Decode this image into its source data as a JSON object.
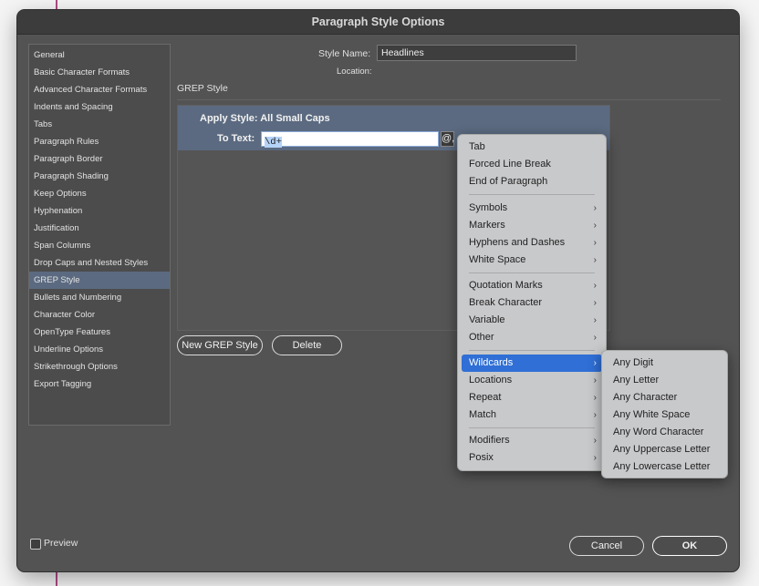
{
  "dialog": {
    "title": "Paragraph Style Options",
    "style_name_label": "Style Name:",
    "style_name_value": "Headlines",
    "location_label": "Location:",
    "section_title": "GREP Style"
  },
  "sidebar": {
    "items": [
      {
        "label": "General"
      },
      {
        "label": "Basic Character Formats"
      },
      {
        "label": "Advanced Character Formats"
      },
      {
        "label": "Indents and Spacing"
      },
      {
        "label": "Tabs"
      },
      {
        "label": "Paragraph Rules"
      },
      {
        "label": "Paragraph Border"
      },
      {
        "label": "Paragraph Shading"
      },
      {
        "label": "Keep Options"
      },
      {
        "label": "Hyphenation"
      },
      {
        "label": "Justification"
      },
      {
        "label": "Span Columns"
      },
      {
        "label": "Drop Caps and Nested Styles"
      },
      {
        "label": "GREP Style"
      },
      {
        "label": "Bullets and Numbering"
      },
      {
        "label": "Character Color"
      },
      {
        "label": "OpenType Features"
      },
      {
        "label": "Underline Options"
      },
      {
        "label": "Strikethrough Options"
      },
      {
        "label": "Export Tagging"
      }
    ],
    "selected": "GREP Style"
  },
  "grep": {
    "apply_style": "Apply Style: All Small Caps",
    "to_text_label": "To Text:",
    "to_text_value": "\\d+",
    "special_char_button": "@,"
  },
  "buttons": {
    "new_grep": "New GREP Style",
    "delete": "Delete",
    "cancel": "Cancel",
    "ok": "OK"
  },
  "preview": {
    "label": "Preview",
    "checked": false
  },
  "menu": {
    "items": [
      {
        "label": "Tab"
      },
      {
        "label": "Forced Line Break"
      },
      {
        "label": "End of Paragraph"
      },
      {
        "label": "Symbols"
      },
      {
        "label": "Markers"
      },
      {
        "label": "Hyphens and Dashes"
      },
      {
        "label": "White Space"
      },
      {
        "label": "Quotation Marks"
      },
      {
        "label": "Break Character"
      },
      {
        "label": "Variable"
      },
      {
        "label": "Other"
      },
      {
        "label": "Wildcards"
      },
      {
        "label": "Locations"
      },
      {
        "label": "Repeat"
      },
      {
        "label": "Match"
      },
      {
        "label": "Modifiers"
      },
      {
        "label": "Posix"
      }
    ],
    "highlighted": "Wildcards",
    "chevron": "›"
  },
  "submenu": {
    "items": [
      {
        "label": "Any Digit"
      },
      {
        "label": "Any Letter"
      },
      {
        "label": "Any Character"
      },
      {
        "label": "Any White Space"
      },
      {
        "label": "Any Word Character"
      },
      {
        "label": "Any Uppercase Letter"
      },
      {
        "label": "Any Lowercase Letter"
      }
    ]
  },
  "colors": {
    "dialog_bg": "#535353",
    "selection_bg": "#5b6a80",
    "menu_highlight": "#2f6fd6",
    "menu_bg": "#c8c9cb"
  }
}
